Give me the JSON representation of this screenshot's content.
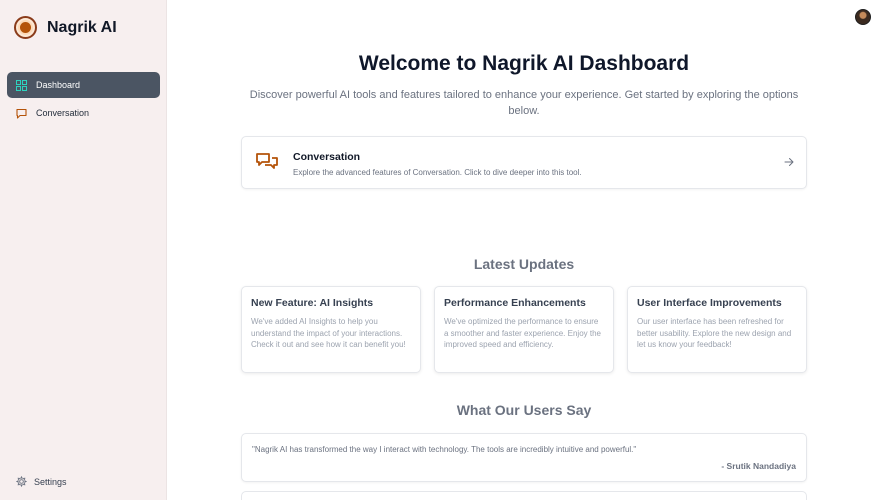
{
  "app": {
    "title": "Nagrik AI"
  },
  "sidebar": {
    "items": [
      {
        "label": "Dashboard",
        "icon": "dashboard-icon",
        "active": true
      },
      {
        "label": "Conversation",
        "icon": "chat-icon",
        "active": false
      }
    ],
    "settings_label": "Settings"
  },
  "main": {
    "title": "Welcome to Nagrik AI Dashboard",
    "subtitle": "Discover powerful AI tools and features tailored to enhance your experience. Get started by exploring the options below.",
    "feature": {
      "title": "Conversation",
      "description": "Explore the advanced features of Conversation. Click to dive deeper into this tool."
    },
    "updates": {
      "heading": "Latest Updates",
      "items": [
        {
          "title": "New Feature: AI Insights",
          "body": "We've added AI Insights to help you understand the impact of your interactions. Check it out and see how it can benefit you!"
        },
        {
          "title": "Performance Enhancements",
          "body": "We've optimized the performance to ensure a smoother and faster experience. Enjoy the improved speed and efficiency."
        },
        {
          "title": "User Interface Improvements",
          "body": "Our user interface has been refreshed for better usability. Explore the new design and let us know your feedback!"
        }
      ]
    },
    "testimonials": {
      "heading": "What Our Users Say",
      "items": [
        {
          "quote": "\"Nagrik AI has transformed the way I interact with technology. The tools are incredibly intuitive and powerful.\"",
          "author": "- Srutik Nandadiya"
        }
      ]
    }
  },
  "colors": {
    "sidebar_bg": "#f7efef",
    "active_nav": "#4b5563",
    "accent_teal": "#2dd4bf",
    "accent_orange": "#b45309"
  }
}
